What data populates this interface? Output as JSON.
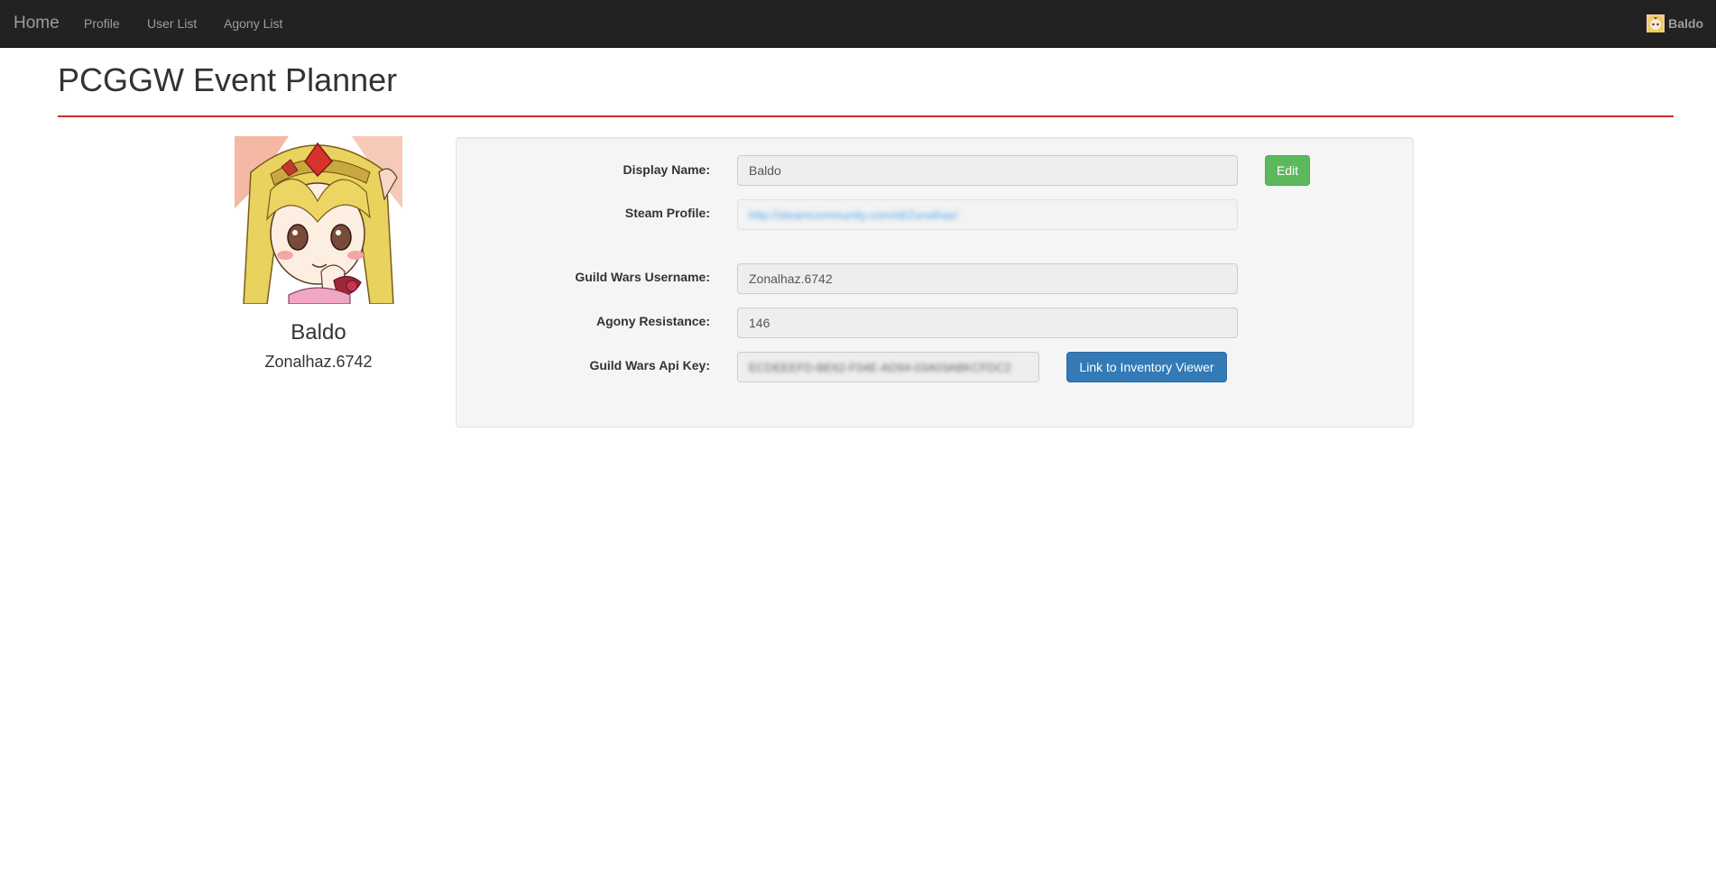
{
  "navbar": {
    "brand": "Home",
    "links": [
      {
        "label": "Profile"
      },
      {
        "label": "User List"
      },
      {
        "label": "Agony List"
      }
    ],
    "user_name": "Baldo"
  },
  "page": {
    "title": "PCGGW Event Planner",
    "accent_color": "#c9302c"
  },
  "profile": {
    "display_name": "Baldo",
    "guild_wars_username": "Zonalhaz.6742"
  },
  "form": {
    "display_name_label": "Display Name:",
    "display_name_value": "Baldo",
    "edit_label": "Edit",
    "steam_profile_label": "Steam Profile:",
    "steam_profile_value": "http://steamcommunity.com/id/Zonalhaz/",
    "gw_username_label": "Guild Wars Username:",
    "gw_username_value": "Zonalhaz.6742",
    "agony_label": "Agony Resistance:",
    "agony_value": "146",
    "api_key_label": "Guild Wars Api Key:",
    "api_key_value": "ECDEEEFD-BE62-F04E-AD94-03A03ABKCFDC2",
    "inventory_button_label": "Link to Inventory Viewer"
  }
}
